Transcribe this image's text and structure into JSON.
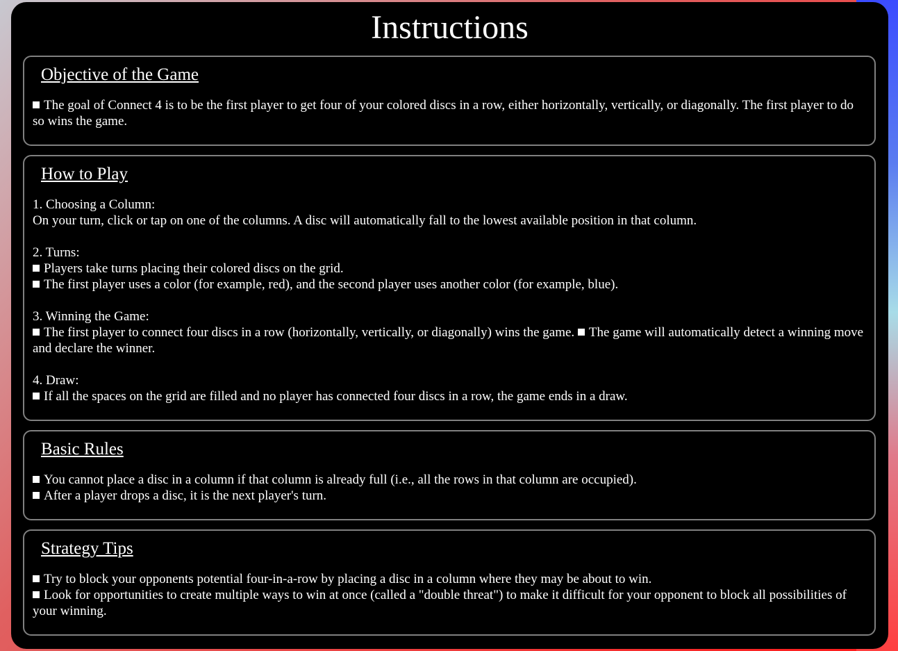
{
  "title": "Instructions",
  "objective": {
    "heading": "Objective of the Game",
    "text": "The goal of Connect 4 is to be the first player to get four of your colored discs in a row, either horizontally, vertically, or diagonally. The first player to do so wins the game."
  },
  "how_to_play": {
    "heading": "How to Play",
    "choosing_title": "1. Choosing a Column:",
    "choosing_text": "On your turn, click or tap on one of the columns. A disc will automatically fall to the lowest available position in that column.",
    "turns_title": "2. Turns:",
    "turns_1": "Players take turns placing their colored discs on the grid.",
    "turns_2": "The first player uses a color (for example, red), and the second player uses another color (for example, blue).",
    "winning_title": "3. Winning the Game:",
    "winning_1": "The first player to connect four discs in a row (horizontally, vertically, or diagonally) wins the game.",
    "winning_2": "The game will automatically detect a winning move and declare the winner.",
    "draw_title": "4. Draw:",
    "draw_1": "If all the spaces on the grid are filled and no player has connected four discs in a row, the game ends in a draw."
  },
  "basic_rules": {
    "heading": "Basic Rules",
    "rule_1": "You cannot place a disc in a column if that column is already full (i.e., all the rows in that column are occupied).",
    "rule_2": "After a player drops a disc, it is the next player's turn."
  },
  "strategy": {
    "heading": "Strategy Tips",
    "tip_1": "Try to block your opponents potential four-in-a-row by placing a disc in a column where they may be about to win.",
    "tip_2": "Look for opportunities to create multiple ways to win at once (called a \"double threat\") to make it difficult for your opponent to block all possibilities of your winning."
  },
  "colors": {
    "panel_bg": "#000000",
    "border": "#808080",
    "text": "#ffffff"
  }
}
